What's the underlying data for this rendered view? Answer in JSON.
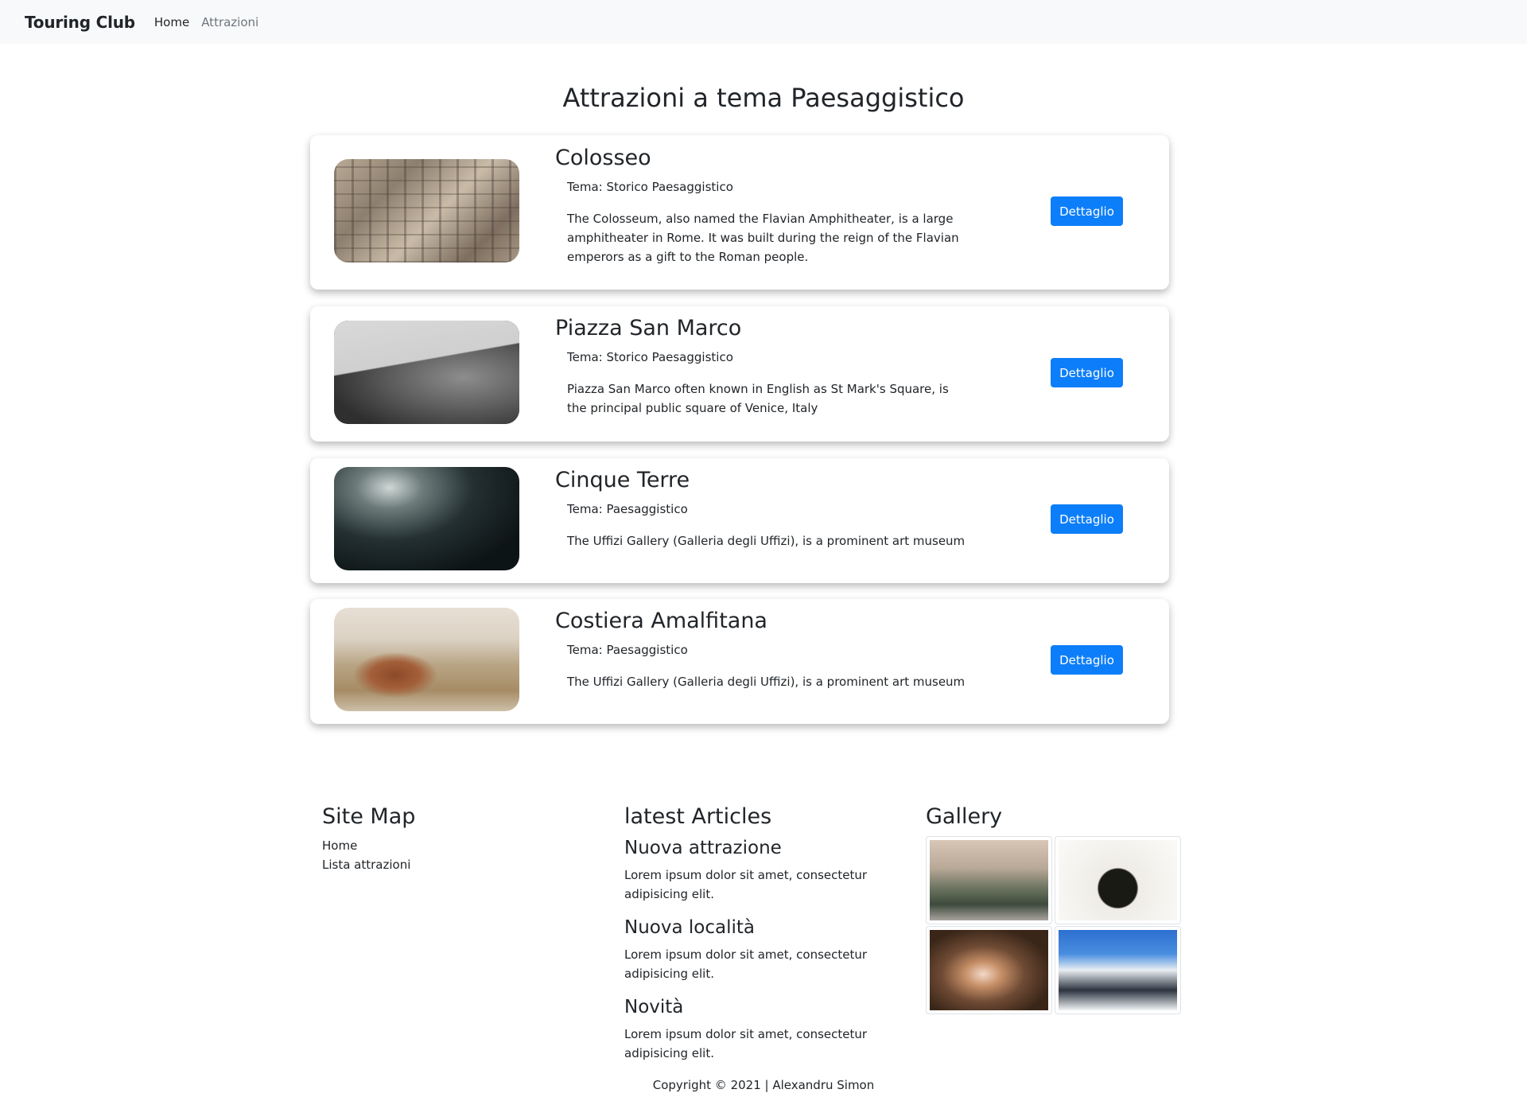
{
  "navbar": {
    "brand": "Touring Club",
    "links": [
      "Home",
      "Attrazioni"
    ]
  },
  "page": {
    "title": "Attrazioni a tema Paesaggistico"
  },
  "attractions": [
    {
      "name": "Colosseo",
      "tema": "Tema: Storico Paesaggistico",
      "description": "The Colosseum, also named the Flavian Amphitheater, is a large amphitheater in Rome. It was built during the reign of the Flavian emperors as a gift to the Roman people.",
      "button": "Dettaglio"
    },
    {
      "name": "Piazza San Marco",
      "tema": "Tema: Storico Paesaggistico",
      "description": "Piazza San Marco often known in English as St Mark's Square, is the principal public square of Venice, Italy",
      "button": "Dettaglio"
    },
    {
      "name": "Cinque Terre",
      "tema": "Tema: Paesaggistico",
      "description": "The Uffizi Gallery (Galleria degli Uffizi), is a prominent art museum",
      "button": "Dettaglio"
    },
    {
      "name": "Costiera Amalfitana",
      "tema": "Tema: Paesaggistico",
      "description": "The Uffizi Gallery (Galleria degli Uffizi), is a prominent art museum",
      "button": "Dettaglio"
    }
  ],
  "footer": {
    "sitemap": {
      "title": "Site Map",
      "links": [
        "Home",
        "Lista attrazioni"
      ]
    },
    "articles": {
      "title": "latest Articles",
      "items": [
        {
          "title": "Nuova attrazione",
          "text": "Lorem ipsum dolor sit amet, consectetur adipisicing elit."
        },
        {
          "title": "Nuova località",
          "text": "Lorem ipsum dolor sit amet, consectetur adipisicing elit."
        },
        {
          "title": "Novità",
          "text": "Lorem ipsum dolor sit amet, consectetur adipisicing elit."
        }
      ]
    },
    "gallery": {
      "title": "Gallery"
    },
    "copyright": "Copyright © 2021 | Alexandru Simon"
  }
}
